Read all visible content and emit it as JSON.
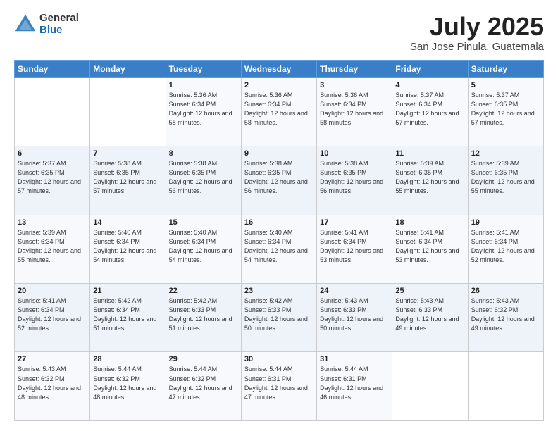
{
  "logo": {
    "general": "General",
    "blue": "Blue"
  },
  "title": {
    "month_year": "July 2025",
    "location": "San Jose Pinula, Guatemala"
  },
  "weekdays": [
    "Sunday",
    "Monday",
    "Tuesday",
    "Wednesday",
    "Thursday",
    "Friday",
    "Saturday"
  ],
  "weeks": [
    [
      {
        "day": "",
        "sunrise": "",
        "sunset": "",
        "daylight": ""
      },
      {
        "day": "",
        "sunrise": "",
        "sunset": "",
        "daylight": ""
      },
      {
        "day": "1",
        "sunrise": "Sunrise: 5:36 AM",
        "sunset": "Sunset: 6:34 PM",
        "daylight": "Daylight: 12 hours and 58 minutes."
      },
      {
        "day": "2",
        "sunrise": "Sunrise: 5:36 AM",
        "sunset": "Sunset: 6:34 PM",
        "daylight": "Daylight: 12 hours and 58 minutes."
      },
      {
        "day": "3",
        "sunrise": "Sunrise: 5:36 AM",
        "sunset": "Sunset: 6:34 PM",
        "daylight": "Daylight: 12 hours and 58 minutes."
      },
      {
        "day": "4",
        "sunrise": "Sunrise: 5:37 AM",
        "sunset": "Sunset: 6:34 PM",
        "daylight": "Daylight: 12 hours and 57 minutes."
      },
      {
        "day": "5",
        "sunrise": "Sunrise: 5:37 AM",
        "sunset": "Sunset: 6:35 PM",
        "daylight": "Daylight: 12 hours and 57 minutes."
      }
    ],
    [
      {
        "day": "6",
        "sunrise": "Sunrise: 5:37 AM",
        "sunset": "Sunset: 6:35 PM",
        "daylight": "Daylight: 12 hours and 57 minutes."
      },
      {
        "day": "7",
        "sunrise": "Sunrise: 5:38 AM",
        "sunset": "Sunset: 6:35 PM",
        "daylight": "Daylight: 12 hours and 57 minutes."
      },
      {
        "day": "8",
        "sunrise": "Sunrise: 5:38 AM",
        "sunset": "Sunset: 6:35 PM",
        "daylight": "Daylight: 12 hours and 56 minutes."
      },
      {
        "day": "9",
        "sunrise": "Sunrise: 5:38 AM",
        "sunset": "Sunset: 6:35 PM",
        "daylight": "Daylight: 12 hours and 56 minutes."
      },
      {
        "day": "10",
        "sunrise": "Sunrise: 5:38 AM",
        "sunset": "Sunset: 6:35 PM",
        "daylight": "Daylight: 12 hours and 56 minutes."
      },
      {
        "day": "11",
        "sunrise": "Sunrise: 5:39 AM",
        "sunset": "Sunset: 6:35 PM",
        "daylight": "Daylight: 12 hours and 55 minutes."
      },
      {
        "day": "12",
        "sunrise": "Sunrise: 5:39 AM",
        "sunset": "Sunset: 6:35 PM",
        "daylight": "Daylight: 12 hours and 55 minutes."
      }
    ],
    [
      {
        "day": "13",
        "sunrise": "Sunrise: 5:39 AM",
        "sunset": "Sunset: 6:34 PM",
        "daylight": "Daylight: 12 hours and 55 minutes."
      },
      {
        "day": "14",
        "sunrise": "Sunrise: 5:40 AM",
        "sunset": "Sunset: 6:34 PM",
        "daylight": "Daylight: 12 hours and 54 minutes."
      },
      {
        "day": "15",
        "sunrise": "Sunrise: 5:40 AM",
        "sunset": "Sunset: 6:34 PM",
        "daylight": "Daylight: 12 hours and 54 minutes."
      },
      {
        "day": "16",
        "sunrise": "Sunrise: 5:40 AM",
        "sunset": "Sunset: 6:34 PM",
        "daylight": "Daylight: 12 hours and 54 minutes."
      },
      {
        "day": "17",
        "sunrise": "Sunrise: 5:41 AM",
        "sunset": "Sunset: 6:34 PM",
        "daylight": "Daylight: 12 hours and 53 minutes."
      },
      {
        "day": "18",
        "sunrise": "Sunrise: 5:41 AM",
        "sunset": "Sunset: 6:34 PM",
        "daylight": "Daylight: 12 hours and 53 minutes."
      },
      {
        "day": "19",
        "sunrise": "Sunrise: 5:41 AM",
        "sunset": "Sunset: 6:34 PM",
        "daylight": "Daylight: 12 hours and 52 minutes."
      }
    ],
    [
      {
        "day": "20",
        "sunrise": "Sunrise: 5:41 AM",
        "sunset": "Sunset: 6:34 PM",
        "daylight": "Daylight: 12 hours and 52 minutes."
      },
      {
        "day": "21",
        "sunrise": "Sunrise: 5:42 AM",
        "sunset": "Sunset: 6:34 PM",
        "daylight": "Daylight: 12 hours and 51 minutes."
      },
      {
        "day": "22",
        "sunrise": "Sunrise: 5:42 AM",
        "sunset": "Sunset: 6:33 PM",
        "daylight": "Daylight: 12 hours and 51 minutes."
      },
      {
        "day": "23",
        "sunrise": "Sunrise: 5:42 AM",
        "sunset": "Sunset: 6:33 PM",
        "daylight": "Daylight: 12 hours and 50 minutes."
      },
      {
        "day": "24",
        "sunrise": "Sunrise: 5:43 AM",
        "sunset": "Sunset: 6:33 PM",
        "daylight": "Daylight: 12 hours and 50 minutes."
      },
      {
        "day": "25",
        "sunrise": "Sunrise: 5:43 AM",
        "sunset": "Sunset: 6:33 PM",
        "daylight": "Daylight: 12 hours and 49 minutes."
      },
      {
        "day": "26",
        "sunrise": "Sunrise: 5:43 AM",
        "sunset": "Sunset: 6:32 PM",
        "daylight": "Daylight: 12 hours and 49 minutes."
      }
    ],
    [
      {
        "day": "27",
        "sunrise": "Sunrise: 5:43 AM",
        "sunset": "Sunset: 6:32 PM",
        "daylight": "Daylight: 12 hours and 48 minutes."
      },
      {
        "day": "28",
        "sunrise": "Sunrise: 5:44 AM",
        "sunset": "Sunset: 6:32 PM",
        "daylight": "Daylight: 12 hours and 48 minutes."
      },
      {
        "day": "29",
        "sunrise": "Sunrise: 5:44 AM",
        "sunset": "Sunset: 6:32 PM",
        "daylight": "Daylight: 12 hours and 47 minutes."
      },
      {
        "day": "30",
        "sunrise": "Sunrise: 5:44 AM",
        "sunset": "Sunset: 6:31 PM",
        "daylight": "Daylight: 12 hours and 47 minutes."
      },
      {
        "day": "31",
        "sunrise": "Sunrise: 5:44 AM",
        "sunset": "Sunset: 6:31 PM",
        "daylight": "Daylight: 12 hours and 46 minutes."
      },
      {
        "day": "",
        "sunrise": "",
        "sunset": "",
        "daylight": ""
      },
      {
        "day": "",
        "sunrise": "",
        "sunset": "",
        "daylight": ""
      }
    ]
  ]
}
